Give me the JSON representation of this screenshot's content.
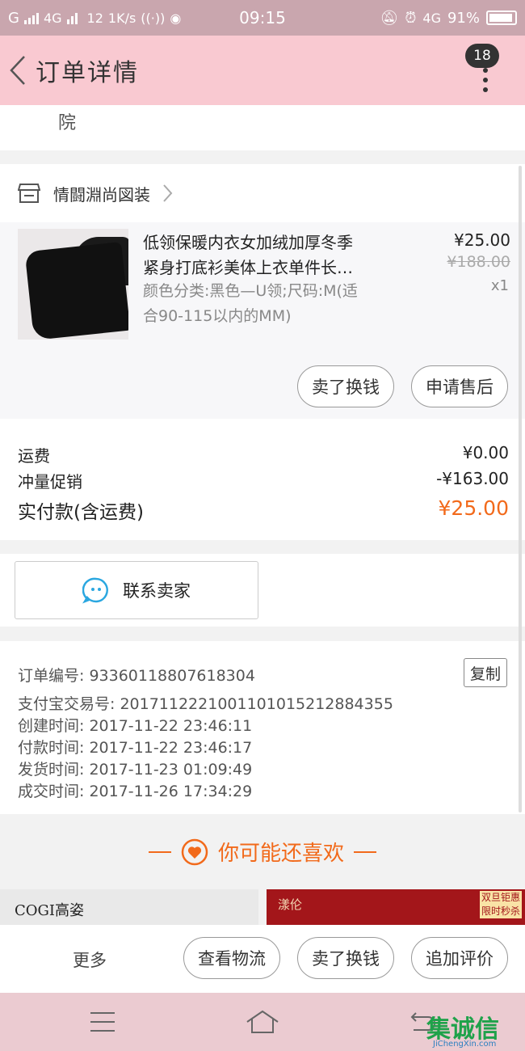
{
  "status_bar": {
    "carrier": "G",
    "network": "4G",
    "speed_prefix": "12",
    "speed": "1K/s",
    "time": "09:15",
    "network2": "4G",
    "battery": "91%"
  },
  "header": {
    "title": "订单详情",
    "badge": "18"
  },
  "address": {
    "tail": "院"
  },
  "shop": {
    "name": "情闘淵尚図装"
  },
  "item": {
    "title_line1": "低领保暖内衣女加绒加厚冬季",
    "title_line2": "紧身打底衫美体上衣单件长…",
    "spec_line1": "颜色分类:黑色—U领;尺码:M(适",
    "spec_line2": "合90-115以内的MM)",
    "price": "¥25.00",
    "original_price": "¥188.00",
    "quantity": "x1",
    "sell_button": "卖了换钱",
    "aftersale_button": "申请售后"
  },
  "totals": {
    "shipping_label": "运费",
    "shipping_value": "¥0.00",
    "promo_label": "冲量促销",
    "promo_value": "-¥163.00",
    "paid_label": "实付款(含运费)",
    "paid_value": "¥25.00"
  },
  "contact": {
    "label": "联系卖家"
  },
  "order_info": {
    "copy_button": "复制",
    "lines": [
      "订单编号: 93360118807618304",
      "支付宝交易号: 2017112221001101015212884355",
      "创建时间: 2017-11-22  23:46:11",
      "付款时间: 2017-11-22  23:46:17",
      "发货时间: 2017-11-23  01:09:49",
      "成交时间: 2017-11-26  17:34:29"
    ]
  },
  "recommend": {
    "title": "你可能还喜欢"
  },
  "banners": {
    "left_brand": "COGI高姿",
    "right_brand": "漾伦",
    "right_deal_line1": "双旦钜惠",
    "right_deal_line2": "限时秒杀"
  },
  "actions": {
    "more": "更多",
    "logistics": "查看物流",
    "sell": "卖了换钱",
    "review": "追加评价"
  },
  "watermark": {
    "logo": "集诚信",
    "url": "JiChengXin.com"
  },
  "colors": {
    "header_bg": "#f9c9d1",
    "status_bg": "#c9a6ae",
    "accent_orange": "#f26a1b",
    "contact_icon": "#2aa7e0"
  }
}
